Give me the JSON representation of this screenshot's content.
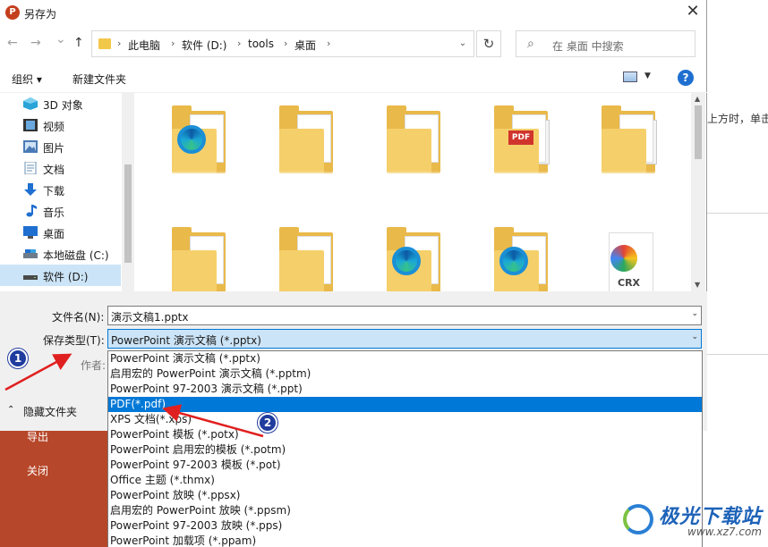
{
  "dialog": {
    "title": "另存为",
    "app_icon_letter": "P",
    "close_symbol": "✕"
  },
  "nav": {
    "back": "←",
    "forward": "→",
    "recent": "⌄",
    "up": "↑",
    "breadcrumbs": [
      "此电脑",
      "软件 (D:)",
      "tools",
      "桌面"
    ],
    "search_placeholder": "在 桌面 中搜索",
    "refresh_symbol": "↻"
  },
  "toolbar": {
    "organize": "组织 ▾",
    "new_folder": "新建文件夹",
    "help": "?"
  },
  "sidebar": {
    "items": [
      {
        "label": "3D 对象",
        "icon": "cube-icon",
        "color": "#29a3d8"
      },
      {
        "label": "视频",
        "icon": "film-icon",
        "color": "#333333"
      },
      {
        "label": "图片",
        "icon": "picture-icon",
        "color": "#4a7ab5"
      },
      {
        "label": "文档",
        "icon": "document-icon",
        "color": "#6a8fb3"
      },
      {
        "label": "下载",
        "icon": "download-arrow-icon",
        "color": "#1e6fd0"
      },
      {
        "label": "音乐",
        "icon": "music-note-icon",
        "color": "#1e6fd0"
      },
      {
        "label": "桌面",
        "icon": "desktop-icon",
        "color": "#1e6fd0"
      },
      {
        "label": "本地磁盘 (C:)",
        "icon": "drive-icon",
        "color": "#6d7b8a"
      },
      {
        "label": "软件 (D:)",
        "icon": "drive-icon",
        "color": "#4a4a4a",
        "selected": true
      }
    ]
  },
  "files": {
    "crx_label": "CRX",
    "pdf_label": "PDF"
  },
  "form": {
    "filename_label": "文件名(N):",
    "filename_value": "演示文稿1.pptx",
    "savetype_label": "保存类型(T):",
    "savetype_value": "PowerPoint 演示文稿 (*.pptx)",
    "author_label": "作者:",
    "hide_folders": "隐藏文件夹"
  },
  "savetype_options": [
    "PowerPoint 演示文稿 (*.pptx)",
    "启用宏的 PowerPoint 演示文稿 (*.pptm)",
    "PowerPoint 97-2003 演示文稿 (*.ppt)",
    "PDF(*.pdf)",
    "XPS 文档(*.xps)",
    "PowerPoint 模板 (*.potx)",
    "PowerPoint 启用宏的模板 (*.potm)",
    "PowerPoint 97-2003 模板 (*.pot)",
    "Office 主题 (*.thmx)",
    "PowerPoint 放映 (*.ppsx)",
    "启用宏的 PowerPoint 放映 (*.ppsm)",
    "PowerPoint 97-2003 放映 (*.pps)",
    "PowerPoint 加载项 (*.ppam)"
  ],
  "selected_option_index": 3,
  "annotations": {
    "badge1": "1",
    "badge2": "2",
    "arrow_color": "#e02020"
  },
  "background": {
    "partial_text": "上方时，单击显",
    "menu_export": "导出",
    "menu_close": "关闭"
  },
  "watermark": {
    "name": "极光下载站",
    "url": "www.xz7.com"
  }
}
